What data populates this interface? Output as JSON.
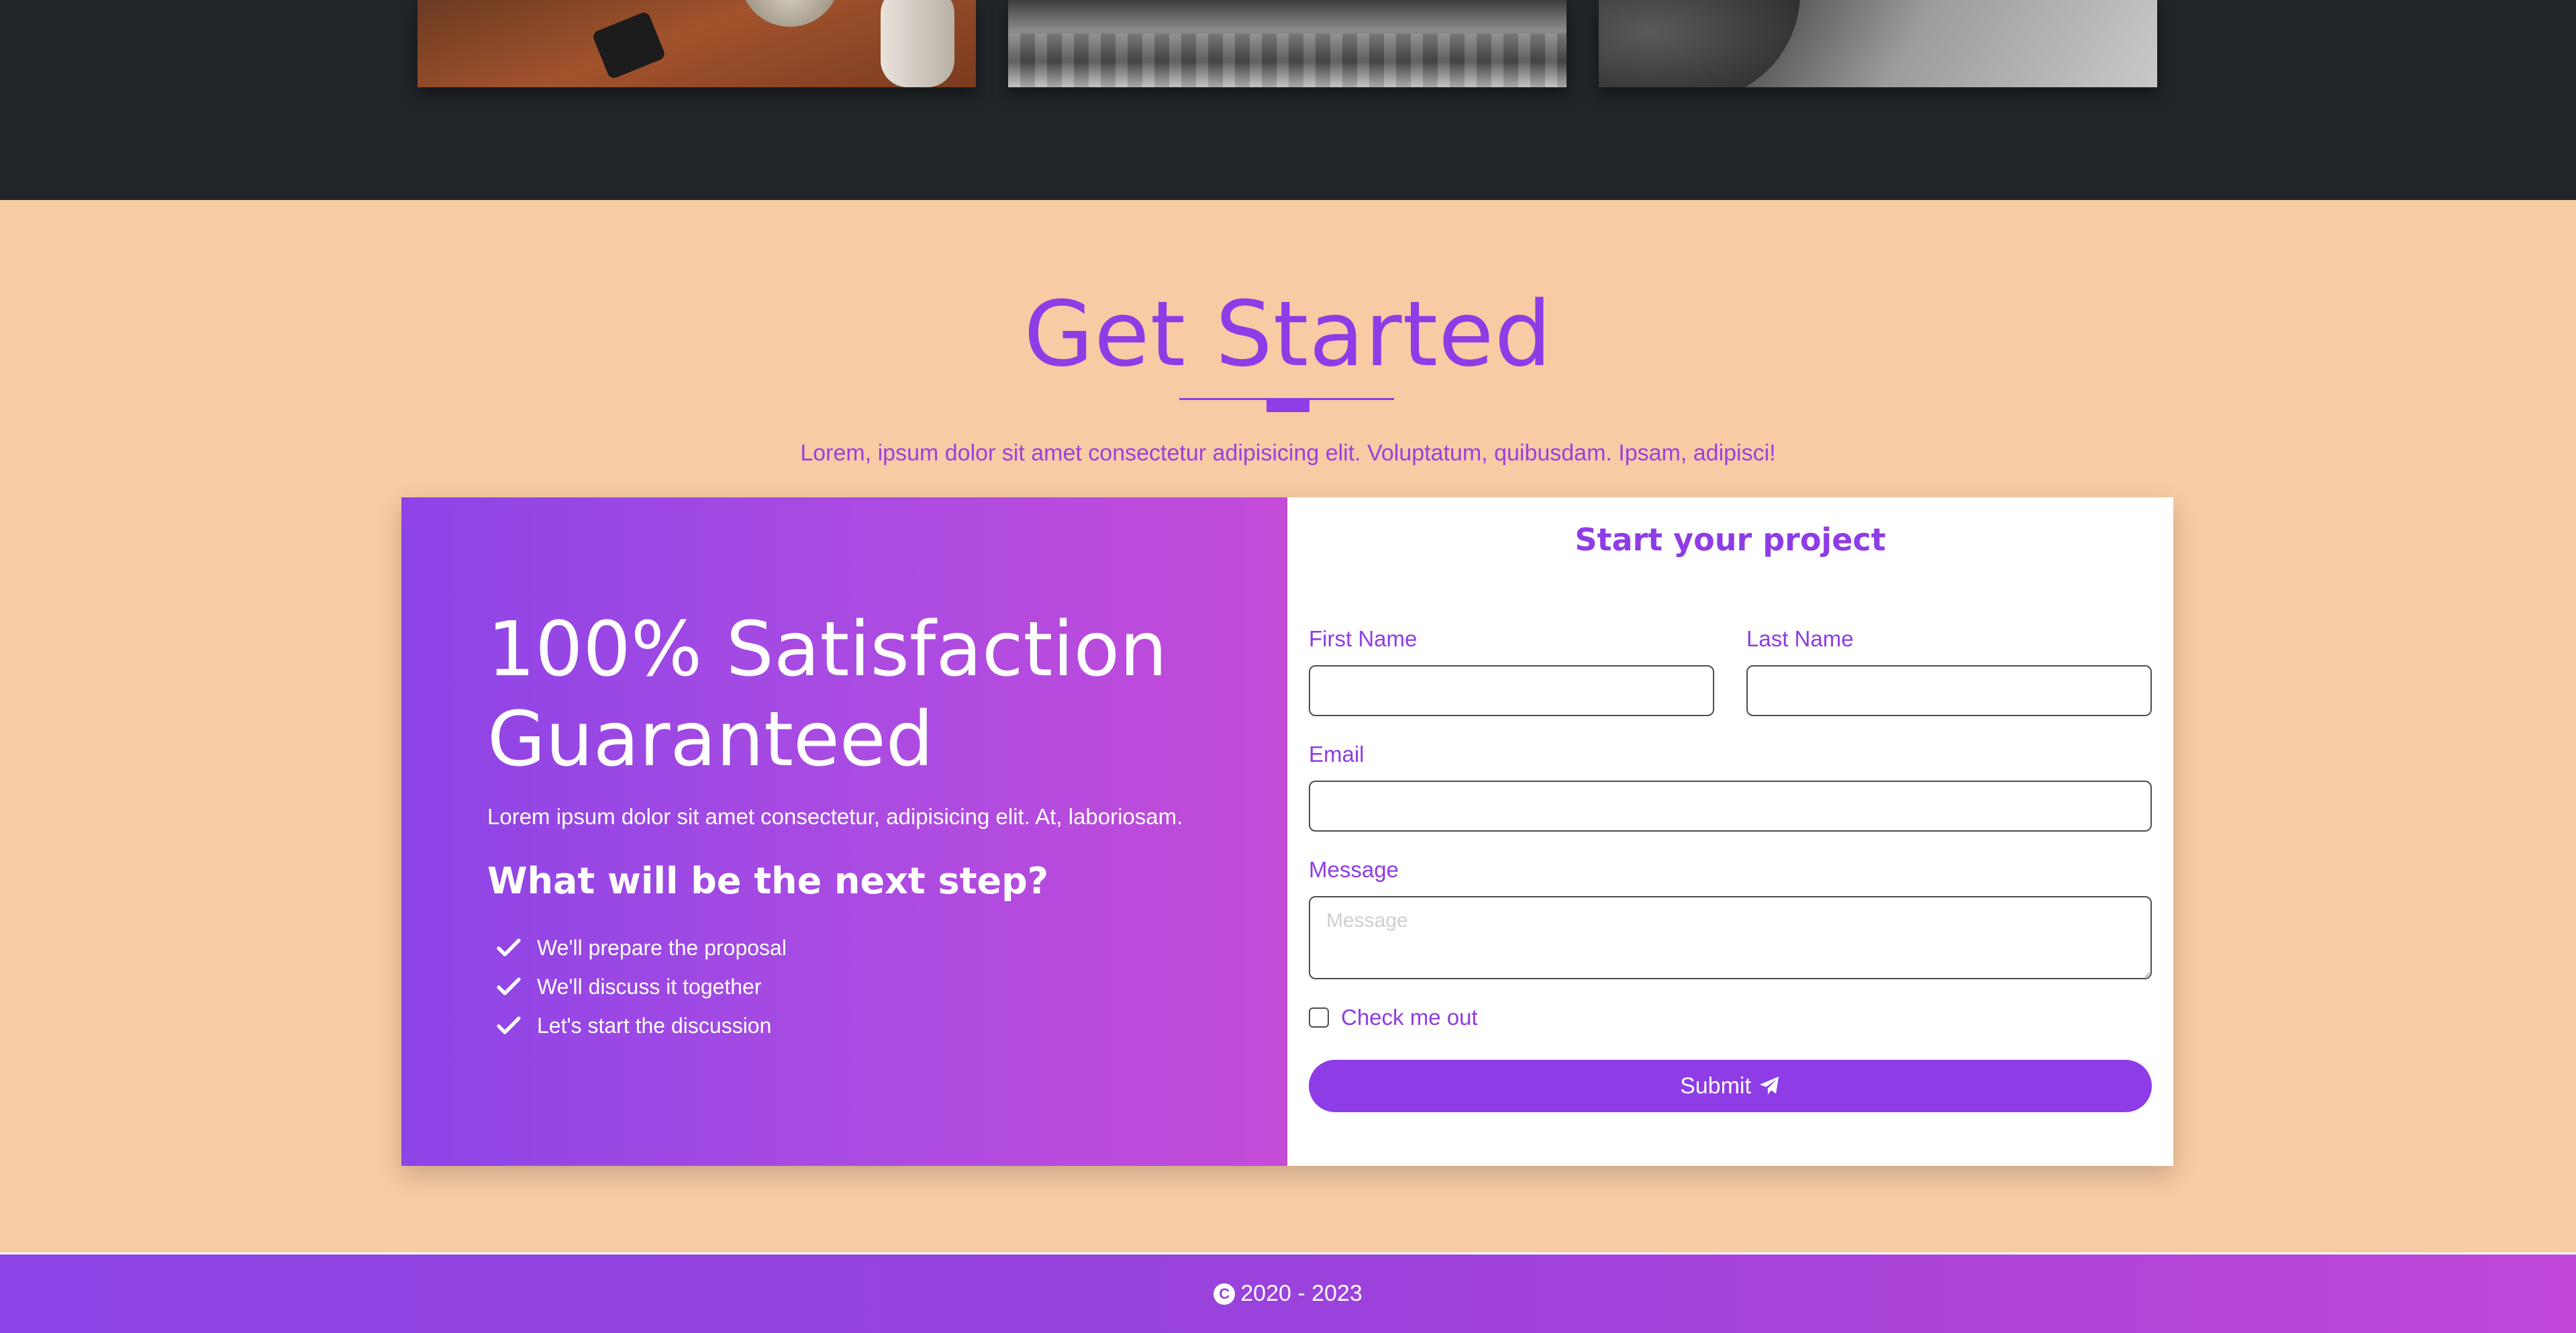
{
  "colors": {
    "accent": "#8e3ce6",
    "section_bg": "#f7cba3",
    "dark_bg": "#212529",
    "gradient_start": "#8c44e6",
    "gradient_end": "#c44bd8"
  },
  "gallery": {
    "images": [
      {
        "icon": "coffee-table-photo"
      },
      {
        "icon": "waterfront-photo"
      },
      {
        "icon": "beach-cliff-photo"
      }
    ]
  },
  "get_started": {
    "title": "Get Started",
    "subtitle": "Lorem, ipsum dolor sit amet consectetur adipisicing elit. Voluptatum, quibusdam. Ipsam, adipisci!"
  },
  "promo": {
    "title_line1": "100% Satisfaction",
    "title_line2": "Guaranteed",
    "text": "Lorem ipsum dolor sit amet consectetur, adipisicing elit. At, laboriosam.",
    "next_heading": "What will be the next step?",
    "steps": [
      "We'll prepare the proposal",
      "We'll discuss it together",
      "Let's start the discussion"
    ],
    "step_icon": "check-icon"
  },
  "form": {
    "title": "Start your project",
    "first_name_label": "First Name",
    "first_name_value": "",
    "last_name_label": "Last Name",
    "last_name_value": "",
    "email_label": "Email",
    "email_value": "",
    "message_label": "Message",
    "message_placeholder": "Message",
    "checkbox_label": "Check me out",
    "checkbox_checked": false,
    "submit_label": "Submit",
    "submit_icon": "paper-plane-icon"
  },
  "footer": {
    "copyright_icon": "copyright-icon",
    "copyright_symbol": "C",
    "text": "2020 - 2023"
  }
}
